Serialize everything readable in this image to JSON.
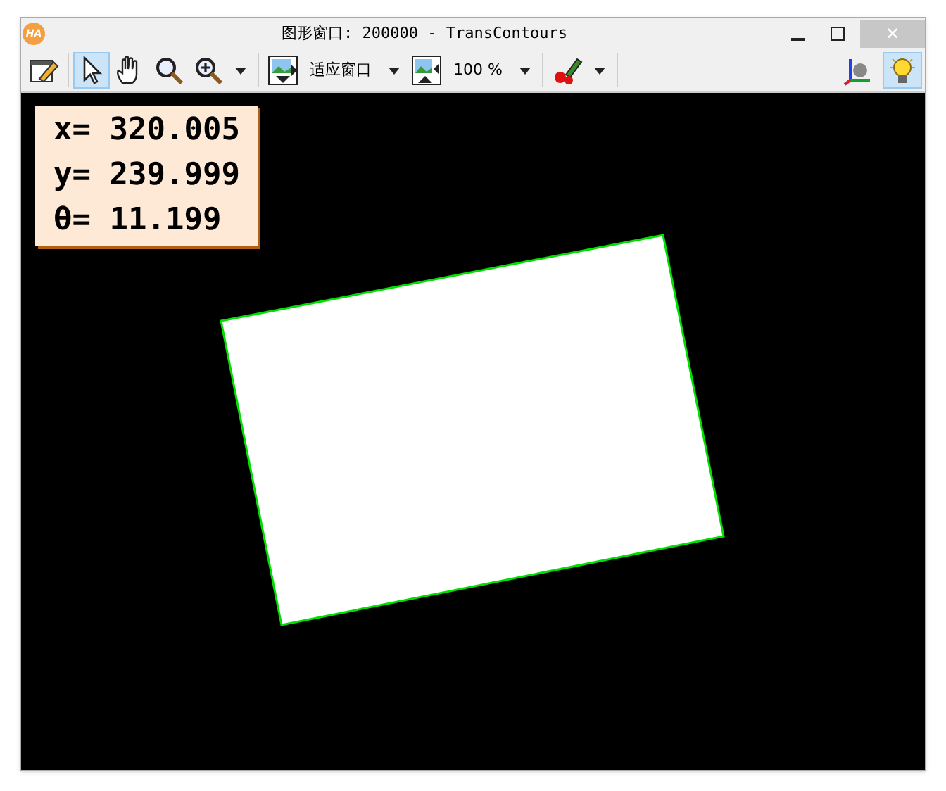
{
  "window": {
    "title": "图形窗口: 200000 - TransContours",
    "logo": "HA",
    "close_glyph": "✕"
  },
  "toolbar": {
    "tools": [
      {
        "kind": "edit",
        "selected": false
      },
      {
        "kind": "pointer",
        "selected": true
      },
      {
        "kind": "hand",
        "selected": false
      },
      {
        "kind": "zoom",
        "selected": false
      },
      {
        "kind": "zoom-in",
        "selected": false,
        "dropdown": true
      },
      {
        "kind": "fit",
        "selected": false,
        "label": "适应窗口",
        "dropdown": true
      },
      {
        "kind": "scale",
        "selected": false,
        "label": "100 %",
        "dropdown": true
      },
      {
        "kind": "color",
        "selected": false,
        "dropdown": true
      }
    ],
    "right_tools": [
      {
        "kind": "axes",
        "selected": false
      },
      {
        "kind": "bulb",
        "selected": true
      }
    ]
  },
  "overlay": {
    "lines": [
      "x= 320.005",
      "y= 239.999",
      "θ= 11.199"
    ]
  }
}
